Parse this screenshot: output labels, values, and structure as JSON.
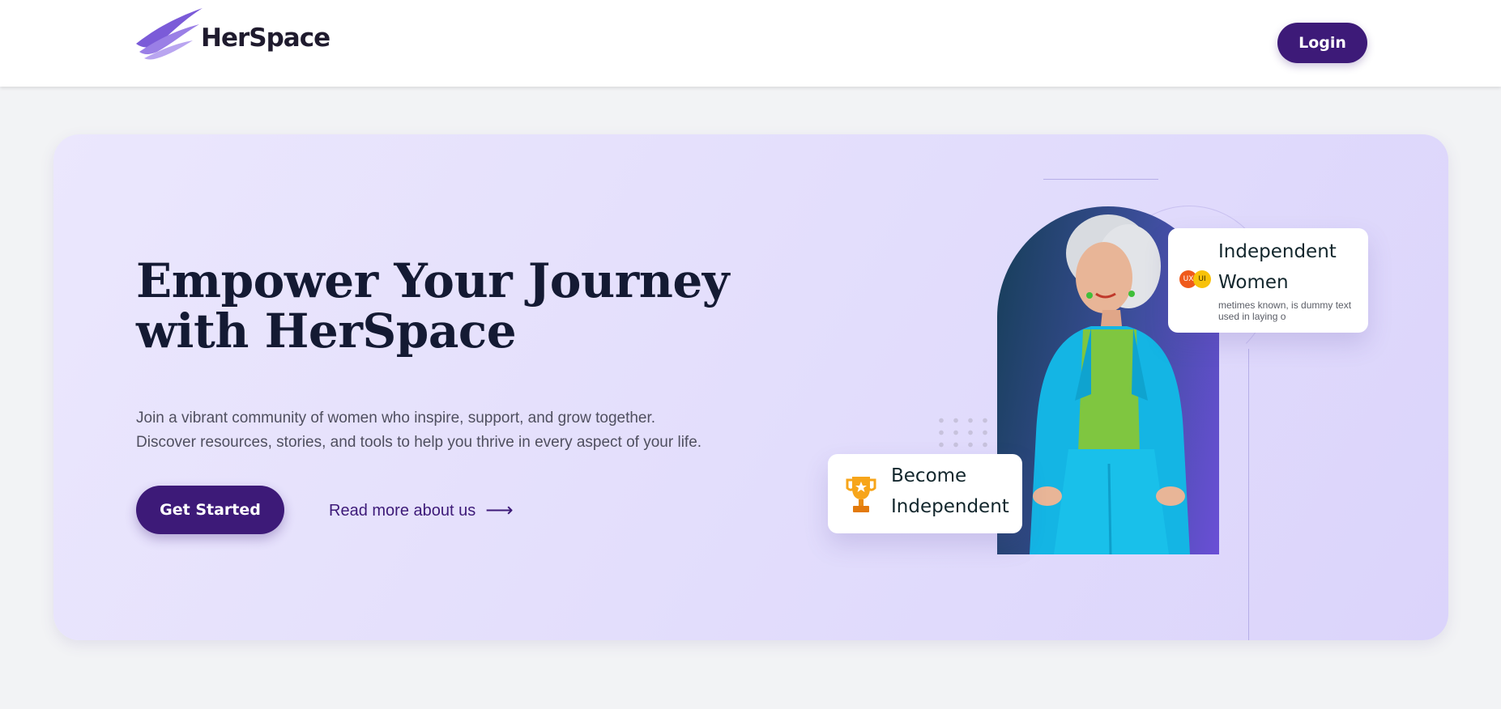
{
  "nav": {
    "brand": "HerSpace",
    "login_label": "Login"
  },
  "hero": {
    "headline_line1": "Empower Your Journey",
    "headline_line2": "with HerSpace",
    "subtext_line1": "Join a vibrant community of women who inspire, support, and grow together.",
    "subtext_line2": "Discover resources, stories, and tools to help you thrive in every aspect of your life.",
    "cta_label": "Get Started",
    "read_more_label": "Read more about us",
    "read_more_arrow": "⟶"
  },
  "cards": {
    "independent": {
      "title_line1": "Independent",
      "title_line2": "Women",
      "description": "metimes known, is dummy text used in laying o",
      "badge_ux": "UX",
      "badge_ui": "UI"
    },
    "become": {
      "title_line1": "Become",
      "title_line2": "Independent"
    }
  },
  "colors": {
    "brand_primary": "#3d1a78",
    "hero_bg": "#e6e1fc",
    "logo_purple": "#8a6ae0",
    "badge_ux": "#ef5a1b",
    "badge_ui": "#f8c20a",
    "trophy": "#f7a51a"
  },
  "icons": {
    "logo": "wing-logo-icon",
    "arrow": "arrow-right-icon",
    "trophy": "trophy-icon"
  }
}
